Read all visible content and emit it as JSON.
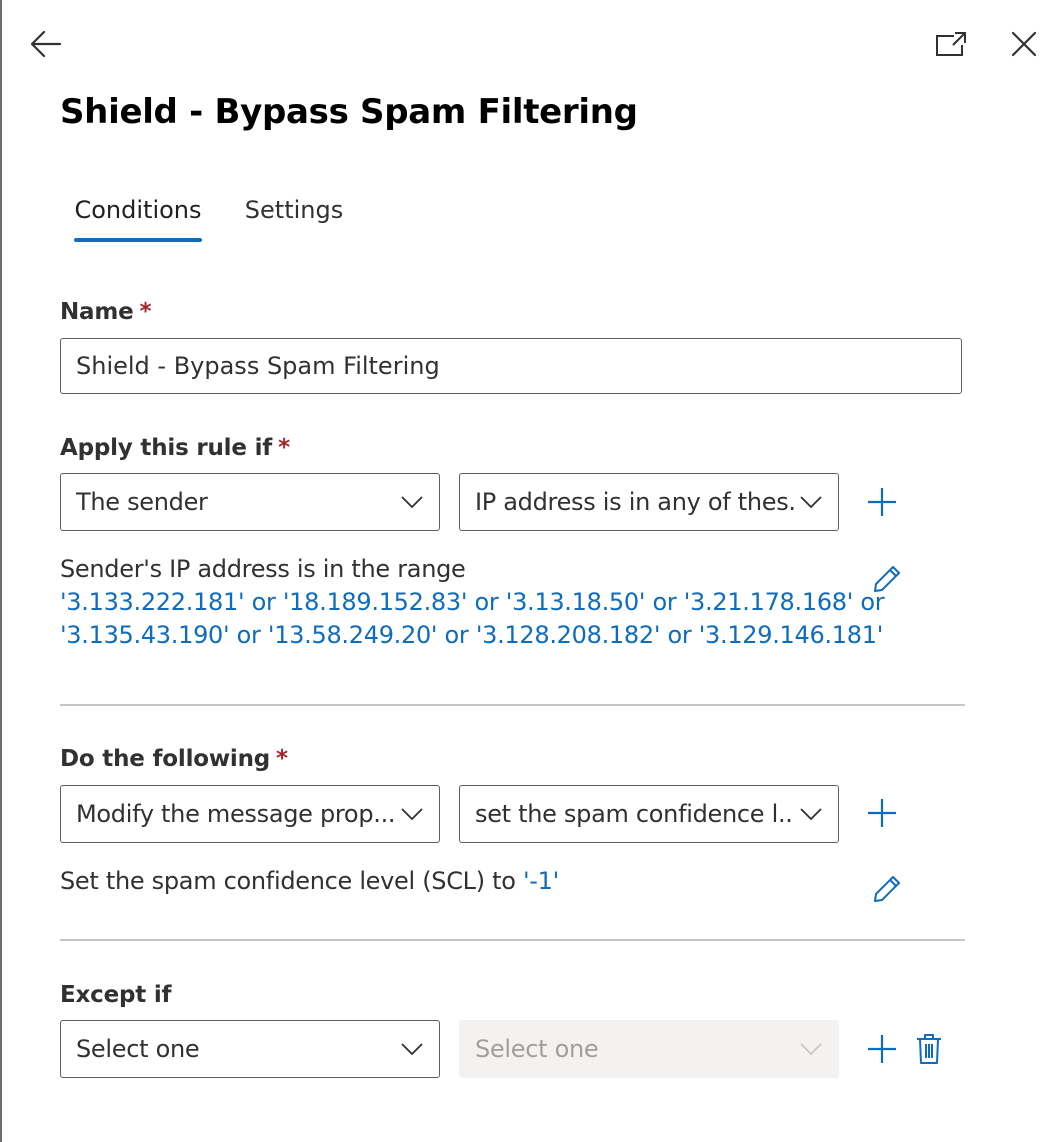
{
  "panel": {
    "title": "Shield - Bypass Spam Filtering",
    "icons": {
      "back": "arrow-left-icon",
      "popout": "open-in-new-window-icon",
      "close": "close-icon"
    }
  },
  "tabs": [
    {
      "label": "Conditions",
      "selected": true
    },
    {
      "label": "Settings",
      "selected": false
    }
  ],
  "form": {
    "name": {
      "label": "Name",
      "required_mark": "*",
      "value": "Shield - Bypass Spam Filtering"
    },
    "apply_rule": {
      "label": "Apply this rule if",
      "required_mark": "*",
      "condition_select": "The sender",
      "property_select": "IP address is in any of thes...",
      "description_prefix": "Sender's IP address is in the range",
      "ip_line_1": "'3.133.222.181' or '18.189.152.83' or '3.13.18.50' or '3.21.178.168' or",
      "ip_line_2": "'3.135.43.190' or '13.58.249.20' or '3.128.208.182' or '3.129.146.181'"
    },
    "do_following": {
      "label": "Do the following",
      "required_mark": "*",
      "action_select": "Modify the message prop...",
      "property_select": "set the spam confidence l...",
      "description_prefix": "Set the spam confidence level (SCL) to",
      "scl_value": "'-1'"
    },
    "except_if": {
      "label": "Except if",
      "condition_select": "Select one",
      "property_select": "Select one",
      "property_select_disabled": true
    }
  },
  "colors": {
    "accent": "#0f6cbd",
    "required": "#a4262c",
    "border": "#605e5c",
    "divider": "#c8c6c4",
    "disabled_bg": "#f3f2f1"
  }
}
